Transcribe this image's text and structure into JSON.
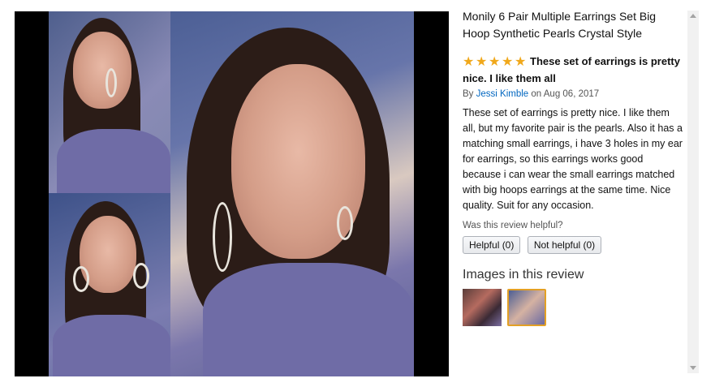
{
  "product": {
    "title": "Monily 6 Pair Multiple Earrings Set Big Hoop Synthetic Pearls Crystal Style"
  },
  "review": {
    "rating": 5,
    "rating_max": 5,
    "headline": "These set of earrings is pretty nice. I like them all",
    "by_prefix": "By",
    "author": "Jessi Kimble",
    "date_prefix": "on",
    "date": "Aug 06, 2017",
    "body": "These set of earrings is pretty nice. I like them all, but my favorite pair is the pearls. Also it has a matching small earrings, i have 3 holes in my ear for earrings, so this earrings works good because i can wear the small earrings matched with big hoops earrings at the same time. Nice quality. Suit for any occasion.",
    "helpful_prompt": "Was this review helpful?",
    "helpful_button": "Helpful (0)",
    "not_helpful_button": "Not helpful (0)"
  },
  "images_section": {
    "title": "Images in this review",
    "selected_index": 1
  },
  "colors": {
    "star": "#f0a81b",
    "link": "#0066c0",
    "selected_border": "#e3a025"
  }
}
